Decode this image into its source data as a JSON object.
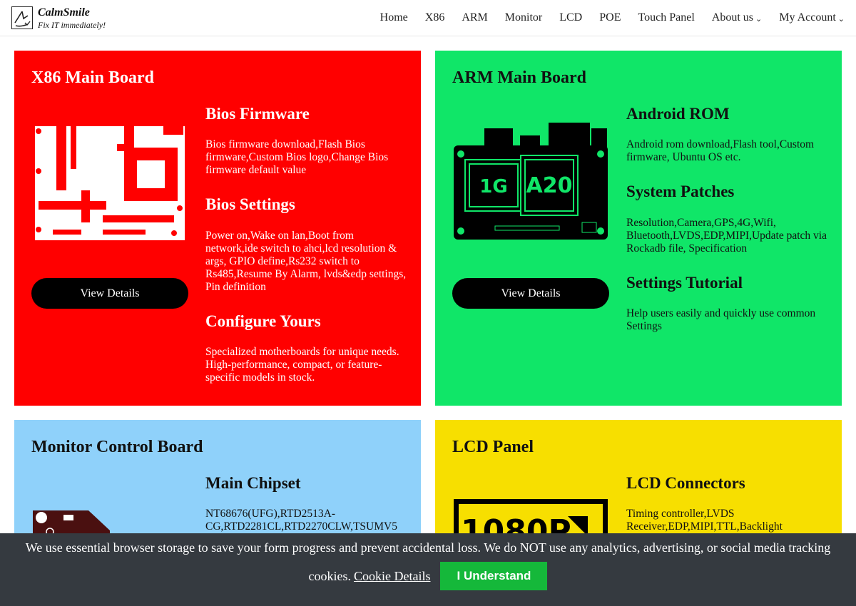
{
  "brand": {
    "name": "CalmSmile",
    "tagline": "Fix IT immediately!"
  },
  "nav": {
    "items": [
      {
        "label": "Home"
      },
      {
        "label": "X86"
      },
      {
        "label": "ARM"
      },
      {
        "label": "Monitor"
      },
      {
        "label": "LCD"
      },
      {
        "label": "POE"
      },
      {
        "label": "Touch Panel"
      },
      {
        "label": "About us",
        "dropdown": true
      },
      {
        "label": "My Account",
        "dropdown": true
      }
    ]
  },
  "cards": {
    "x86": {
      "title": "X86 Main Board",
      "button": "View Details",
      "color": "#ff0000",
      "features": [
        {
          "heading": "Bios Firmware",
          "text": "Bios firmware download,Flash Bios firmware,Custom Bios logo,Change Bios firmware default value"
        },
        {
          "heading": "Bios Settings",
          "text": "Power on,Wake on lan,Boot from network,ide switch to ahci,lcd resolution & args, GPIO define,Rs232 switch to Rs485,Resume By Alarm, lvds&edp settings, Pin definition"
        },
        {
          "heading": "Configure Yours",
          "text": "Specialized motherboards for unique needs. High-performance, compact, or feature-specific models in stock."
        }
      ]
    },
    "arm": {
      "title": "ARM Main Board",
      "button": "View Details",
      "color": "#10e668",
      "chip_labels": [
        "1G",
        "A20"
      ],
      "features": [
        {
          "heading": "Android ROM",
          "text": "Android rom download,Flash tool,Custom firmware, Ubuntu OS etc."
        },
        {
          "heading": "System Patches",
          "text": "Resolution,Camera,GPS,4G,Wifi, Bluetooth,LVDS,EDP,MIPI,Update patch via Rockadb file, Specification"
        },
        {
          "heading": "Settings Tutorial",
          "text": "Help users easily and quickly use common Settings"
        }
      ]
    },
    "monitor": {
      "title": "Monitor Control Board",
      "color": "#8fd1fa",
      "features": [
        {
          "heading": "Main Chipset",
          "text": "NT68676(UFG),RTD2513A-CG,RTD2281CL,RTD2270CLW,TSUMV5"
        }
      ]
    },
    "lcd": {
      "title": "LCD Panel",
      "color": "#f7df00",
      "image_text": "1080P",
      "features": [
        {
          "heading": "LCD Connectors",
          "text": "Timing controller,LVDS Receiver,EDP,MIPI,TTL,Backlight"
        }
      ]
    }
  },
  "cookie": {
    "message": "We use essential browser storage to save your form progress and prevent accidental loss. We do NOT use any analytics, advertising, or social media tracking",
    "message_end": "cookies.",
    "link": "Cookie Details",
    "button": "I Understand"
  }
}
